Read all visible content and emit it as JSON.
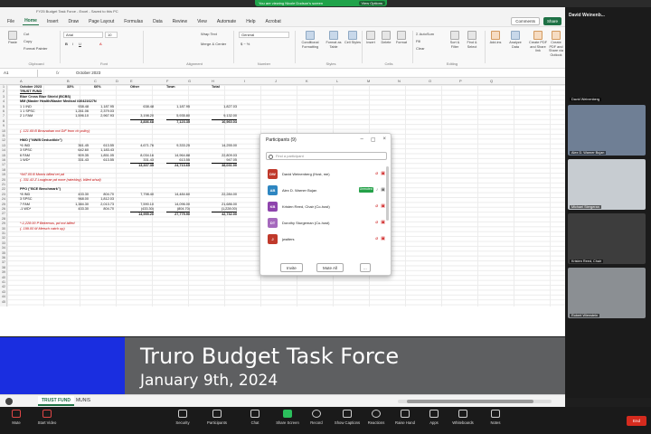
{
  "zoom": {
    "share_banner": "You are viewing Nicole Dodson's screen",
    "stop_share": "View Options"
  },
  "excel": {
    "title": "FY25 Budget Task Force - Excel - Saved to this PC",
    "menu_tabs": [
      "File",
      "Home",
      "Insert",
      "Draw",
      "Page Layout",
      "Formulas",
      "Data",
      "Review",
      "View",
      "Automate",
      "Help",
      "Acrobat"
    ],
    "active_tab": "Home",
    "comments_label": "Comments",
    "share_label": "Share",
    "ribbon": {
      "clipboard": {
        "paste": "Paste",
        "cut": "Cut",
        "copy": "Copy",
        "format_painter": "Format Painter",
        "group": "Clipboard"
      },
      "font": {
        "name": "Arial",
        "size": "10",
        "group": "Font"
      },
      "alignment": {
        "wrap": "Wrap Text",
        "merge": "Merge & Center",
        "group": "Alignment"
      },
      "number": {
        "format": "General",
        "group": "Number"
      },
      "styles": {
        "conditional": "Conditional Formatting",
        "table": "Format as Table",
        "cell": "Cell Styles",
        "group": "Styles"
      },
      "cells": {
        "insert": "Insert",
        "delete": "Delete",
        "format": "Format",
        "group": "Cells"
      },
      "editing": {
        "autosum": "AutoSum",
        "fill": "Fill",
        "clear": "Clear",
        "sort": "Sort & Filter",
        "find": "Find & Select",
        "group": "Editing"
      },
      "addins": {
        "label": "Add-ins",
        "group": "Add-ins"
      },
      "analysis": {
        "label": "Analyze Data",
        "group": "Analysis"
      },
      "acrobat": {
        "create_pdf": "Create PDF and Share link",
        "create_share": "Create PDF and Share via Outlook",
        "group": "Adobe Acrobat"
      }
    },
    "formula_bar": {
      "name_box": "A1",
      "fx": "fx",
      "value": "October 2023"
    },
    "columns": [
      "A",
      "B",
      "C",
      "D",
      "E",
      "F",
      "G",
      "H",
      "I",
      "J",
      "K",
      "L",
      "M",
      "N",
      "O",
      "P",
      "Q"
    ],
    "cells": [
      {
        "r": 1,
        "c": "A",
        "t": "October 2023",
        "cls": "b"
      },
      {
        "r": 1,
        "c": "B",
        "t": "33%",
        "cls": "b"
      },
      {
        "r": 1,
        "c": "C",
        "t": "66%",
        "cls": "b"
      },
      {
        "r": 1,
        "c": "E",
        "t": "Other",
        "cls": "b"
      },
      {
        "r": 1,
        "c": "F",
        "t": "Town",
        "cls": "b"
      },
      {
        "r": 1,
        "c": "H",
        "t": "Total",
        "cls": "b"
      },
      {
        "r": 2,
        "c": "A",
        "t": "TRUST FUND",
        "cls": "b u"
      },
      {
        "r": 3,
        "c": "A",
        "t": "Blue Cross Blue Shield (BCBS)",
        "cls": "b"
      },
      {
        "r": 4,
        "c": "A",
        "t": "MM (Master Health/Master Medical #30421627N",
        "cls": "b"
      },
      {
        "r": 5,
        "c": "A",
        "t": "1     1     IND"
      },
      {
        "r": 5,
        "c": "B",
        "t": "938.48",
        "cls": "r"
      },
      {
        "r": 5,
        "c": "C",
        "t": "1,187.95",
        "cls": "r"
      },
      {
        "r": 5,
        "c": "E",
        "t": "638.48",
        "cls": "r"
      },
      {
        "r": 5,
        "c": "F",
        "t": "1,187.95",
        "cls": "r"
      },
      {
        "r": 5,
        "c": "H",
        "t": "1,827.03",
        "cls": "r"
      },
      {
        "r": 6,
        "c": "A",
        "t": "1     1     SPSC"
      },
      {
        "r": 6,
        "c": "B",
        "t": "1,261.06",
        "cls": "r"
      },
      {
        "r": 6,
        "c": "C",
        "t": "2,379.03",
        "cls": "r"
      },
      {
        "r": 7,
        "c": "A",
        "t": "2     1     FAM"
      },
      {
        "r": 7,
        "c": "B",
        "t": "1,596.10",
        "cls": "r"
      },
      {
        "r": 7,
        "c": "C",
        "t": "2,967.93",
        "cls": "r"
      },
      {
        "r": 7,
        "c": "E",
        "t": "3,198.20",
        "cls": "r"
      },
      {
        "r": 7,
        "c": "F",
        "t": "5,935.80",
        "cls": "r"
      },
      {
        "r": 7,
        "c": "H",
        "t": "9,132.00",
        "cls": "r"
      },
      {
        "r": 8,
        "c": "E",
        "t": "3,836.68",
        "cls": "b r border-top"
      },
      {
        "r": 8,
        "c": "F",
        "t": "7,123.35",
        "cls": "b r border-top"
      },
      {
        "r": 8,
        "c": "H",
        "t": "10,960.03",
        "cls": "b r border-top"
      },
      {
        "r": 10,
        "c": "A",
        "t": "(- 121.69 B Brosnahan not D/F from ch policy)",
        "cls": "red"
      },
      {
        "r": 12,
        "c": "A",
        "t": "HMO (\"NW/B Deductible\")",
        "cls": "b"
      },
      {
        "r": 13,
        "c": "A",
        "t": "*6    IND"
      },
      {
        "r": 13,
        "c": "B",
        "t": "361.45",
        "cls": "r"
      },
      {
        "r": 13,
        "c": "C",
        "t": "613.55",
        "cls": "r"
      },
      {
        "r": 13,
        "c": "E",
        "t": "4,671.76",
        "cls": "r"
      },
      {
        "r": 13,
        "c": "F",
        "t": "9,333.25",
        "cls": "r"
      },
      {
        "r": 13,
        "c": "H",
        "t": "14,255.00",
        "cls": "r"
      },
      {
        "r": 14,
        "c": "A",
        "t": "3     SPSC"
      },
      {
        "r": 14,
        "c": "B",
        "t": "642.60",
        "cls": "r"
      },
      {
        "r": 14,
        "c": "C",
        "t": "1,183.43",
        "cls": "r"
      },
      {
        "r": 15,
        "c": "A",
        "t": "6     FAM"
      },
      {
        "r": 15,
        "c": "B",
        "t": "909.35",
        "cls": "r"
      },
      {
        "r": 15,
        "c": "C",
        "t": "1,851.05",
        "cls": "r"
      },
      {
        "r": 15,
        "c": "E",
        "t": "8,034.16",
        "cls": "r"
      },
      {
        "r": 15,
        "c": "F",
        "t": "14,964.88",
        "cls": "r"
      },
      {
        "r": 15,
        "c": "H",
        "t": "22,809.03",
        "cls": "r"
      },
      {
        "r": 16,
        "c": "A",
        "t": "1     WD*"
      },
      {
        "r": 16,
        "c": "B",
        "t": "331.43",
        "cls": "r"
      },
      {
        "r": 16,
        "c": "C",
        "t": "613.55",
        "cls": "r"
      },
      {
        "r": 16,
        "c": "E",
        "t": "331.43",
        "cls": "r"
      },
      {
        "r": 16,
        "c": "F",
        "t": "613.55",
        "cls": "r"
      },
      {
        "r": 16,
        "c": "H",
        "t": "947.05",
        "cls": "r"
      },
      {
        "r": 17,
        "c": "E",
        "t": "13,337.35",
        "cls": "b r border-top"
      },
      {
        "r": 17,
        "c": "F",
        "t": "24,713.65",
        "cls": "b r border-top"
      },
      {
        "r": 17,
        "c": "H",
        "t": "38,031.00",
        "cls": "b r border-top"
      },
      {
        "r": 19,
        "c": "A",
        "t": "*947.05 B Morris billed ret pd",
        "cls": "red"
      },
      {
        "r": 20,
        "c": "A",
        "t": "(- 331.43 Z Loughran pd none (rate/day), billed w/sal)",
        "cls": "red"
      },
      {
        "r": 22,
        "c": "A",
        "t": "PPO (\"BCE Benchmark\")",
        "cls": "b"
      },
      {
        "r": 23,
        "c": "A",
        "t": "*8    IND"
      },
      {
        "r": 23,
        "c": "B",
        "t": "433.30",
        "cls": "r"
      },
      {
        "r": 23,
        "c": "C",
        "t": "804.70",
        "cls": "r"
      },
      {
        "r": 23,
        "c": "E",
        "t": "7,798.40",
        "cls": "r"
      },
      {
        "r": 23,
        "c": "F",
        "t": "14,484.60",
        "cls": "r"
      },
      {
        "r": 23,
        "c": "H",
        "t": "22,284.00",
        "cls": "r"
      },
      {
        "r": 24,
        "c": "A",
        "t": "3     SPSC"
      },
      {
        "r": 24,
        "c": "B",
        "t": "968.00",
        "cls": "r"
      },
      {
        "r": 24,
        "c": "C",
        "t": "1,812.03",
        "cls": "r"
      },
      {
        "r": 25,
        "c": "A",
        "t": "7     FAM"
      },
      {
        "r": 25,
        "c": "B",
        "t": "1,384.30",
        "cls": "r"
      },
      {
        "r": 25,
        "c": "C",
        "t": "2,013.73",
        "cls": "r"
      },
      {
        "r": 25,
        "c": "E",
        "t": "7,590.10",
        "cls": "r"
      },
      {
        "r": 25,
        "c": "F",
        "t": "14,096.00",
        "cls": "r"
      },
      {
        "r": 25,
        "c": "H",
        "t": "21,686.00",
        "cls": "r"
      },
      {
        "r": 26,
        "c": "A",
        "t": "-1    WD*"
      },
      {
        "r": 26,
        "c": "B",
        "t": "433.30",
        "cls": "r"
      },
      {
        "r": 26,
        "c": "C",
        "t": "804.70",
        "cls": "r"
      },
      {
        "r": 26,
        "c": "E",
        "t": "(433.30)",
        "cls": "r"
      },
      {
        "r": 26,
        "c": "F",
        "t": "(804.70)",
        "cls": "r"
      },
      {
        "r": 26,
        "c": "H",
        "t": "(1,228.00)",
        "cls": "r"
      },
      {
        "r": 27,
        "c": "E",
        "t": "14,955.20",
        "cls": "b r border-top"
      },
      {
        "r": 27,
        "c": "F",
        "t": "27,775.90",
        "cls": "b r border-top"
      },
      {
        "r": 27,
        "c": "H",
        "t": "42,732.00",
        "cls": "b r border-top"
      },
      {
        "r": 29,
        "c": "A",
        "t": "*-1,228.00 P Bekemus, pd not billed",
        "cls": "red"
      },
      {
        "r": 30,
        "c": "A",
        "t": "(- 199.00 M Mersch catch up)",
        "cls": "red"
      }
    ],
    "sheet_tabs": [
      "TRUST FUND",
      "MUNIS"
    ],
    "active_sheet": "TRUST FUND"
  },
  "participants": {
    "title": "Participants (9)",
    "search_placeholder": "Find a participant",
    "list": [
      {
        "initials": "DW",
        "name": "David Weinenberg (Host, me)",
        "color": "#c0392b",
        "mic": "muted",
        "video": "off"
      },
      {
        "initials": "AB",
        "name": "Alex D. Warner Bujan",
        "color": "#2e86c1",
        "mic": "unmuted",
        "video": "on",
        "tag": "Unmuted"
      },
      {
        "initials": "KB",
        "name": "Kristen Reed, Chair (Co-host)",
        "color": "#8e44ad",
        "mic": "muted",
        "video": "off"
      },
      {
        "initials": "DT",
        "name": "Dorothy Sturgeman (Co-host)",
        "color": "#a569bd",
        "mic": "muted",
        "video": "off"
      },
      {
        "initials": "J",
        "name": "jwalters",
        "color": "#c0392b",
        "mic": "muted",
        "video": "off"
      }
    ],
    "invite_label": "Invite",
    "mute_all_label": "Mute All",
    "more_label": "..."
  },
  "gallery": {
    "header": "David Weinenb...",
    "tiles": [
      {
        "label": "David Weinenberg",
        "bg": "#2a2a2a"
      },
      {
        "label": "Alex D. Warner Bujan",
        "bg": "#6f7f95"
      },
      {
        "label": "Michael Stergeran",
        "bg": "#c7ccd1"
      },
      {
        "label": "Kristen Reed, Chair",
        "bg": "#3d3d3d"
      },
      {
        "label": "Robert Wienstein",
        "bg": "#8b8f93"
      }
    ]
  },
  "overlay": {
    "title": "Truro Budget Task Force",
    "date": "January 9th, 2024",
    "blue": "#1a2ee0",
    "gray": "#5e5f61"
  },
  "toolbar": {
    "items": [
      "Mute",
      "Start Video",
      "Security",
      "Participants",
      "Chat",
      "Share Screen",
      "Record",
      "Show Captions",
      "Reactions",
      "Raise Hand",
      "Apps",
      "Whiteboards",
      "Notes"
    ],
    "end_label": "End"
  }
}
